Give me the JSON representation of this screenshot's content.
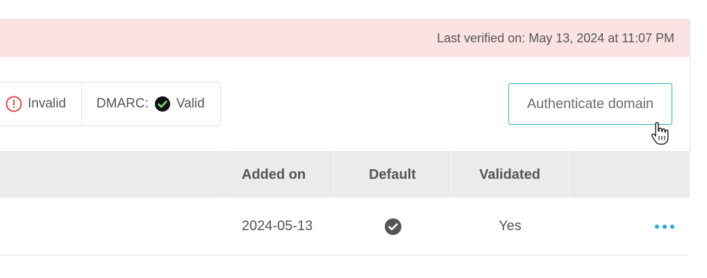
{
  "verification": {
    "last_verified_label": "Last verified on: May 13, 2024 at 11:07 PM"
  },
  "status": {
    "items": [
      {
        "prefix": "",
        "label": "Invalid",
        "icon": "warning-circle-icon",
        "color": "#e0454f"
      },
      {
        "prefix": "DMARC:",
        "label": "Valid",
        "icon": "check-circle-icon",
        "color": "#111111"
      }
    ]
  },
  "actions": {
    "authenticate_label": "Authenticate domain"
  },
  "table": {
    "headers": [
      "Added on",
      "Default",
      "Validated"
    ],
    "rows": [
      {
        "added_on": "2024-05-13",
        "default_icon": "check-circle-icon",
        "validated": "Yes"
      }
    ]
  },
  "colors": {
    "alert_bg": "#fbe3e4",
    "accent_border": "#29b3b8",
    "more_dots": "#29a8e0",
    "valid_check": "#7be07b"
  }
}
